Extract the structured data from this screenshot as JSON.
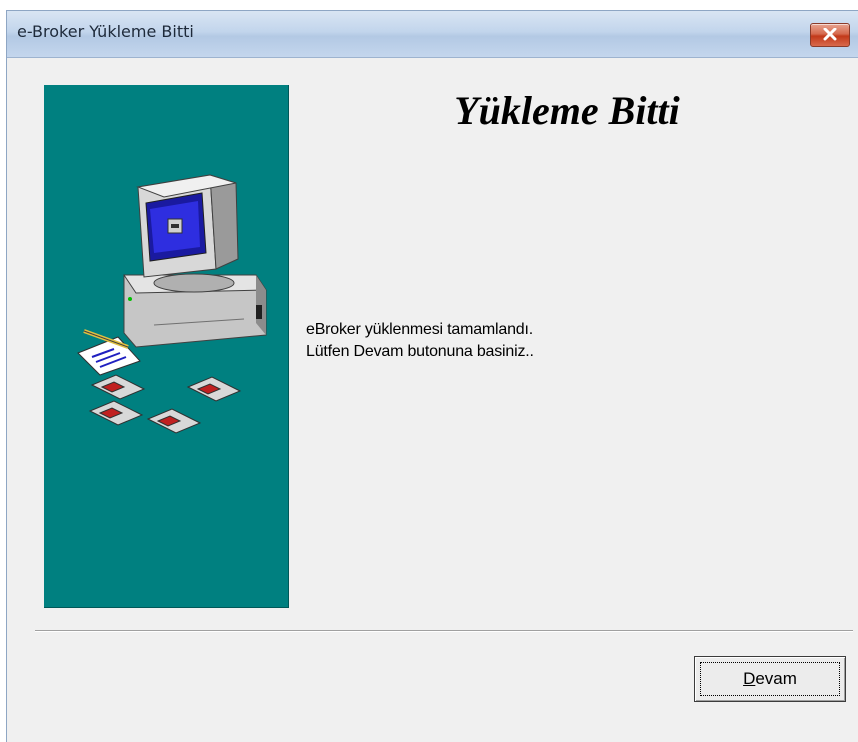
{
  "window": {
    "title": "e-Broker Yükleme Bitti",
    "close_icon": "close-icon"
  },
  "content": {
    "heading": "Yükleme Bitti",
    "message_line1": "eBroker yüklenmesi tamamlandı.",
    "message_line2": "Lütfen Devam butonuna basiniz.."
  },
  "buttons": {
    "devam_mnemonic": "D",
    "devam_rest": "evam"
  },
  "illustration": {
    "icon": "computer-setup-illustration",
    "background_color": "#008080"
  }
}
